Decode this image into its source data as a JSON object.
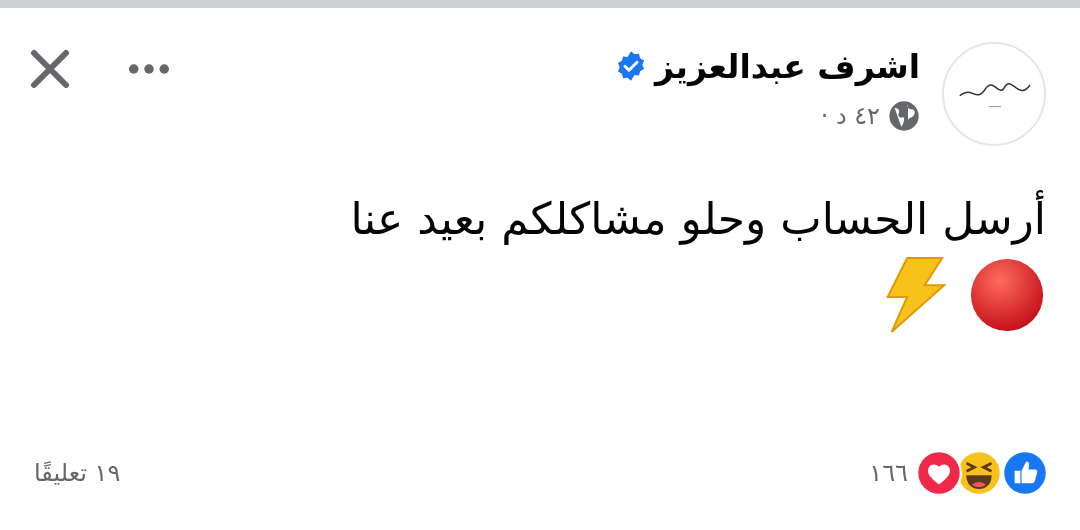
{
  "post": {
    "author": "اشرف عبدالعزيز",
    "verified": true,
    "time": "٤٢ د ·",
    "text": "أرسل الحساب وحلو مشاكلكم بعيد عنا"
  },
  "footer": {
    "reactions_count": "١٦٦",
    "comments": "١٩ تعليقًا"
  }
}
